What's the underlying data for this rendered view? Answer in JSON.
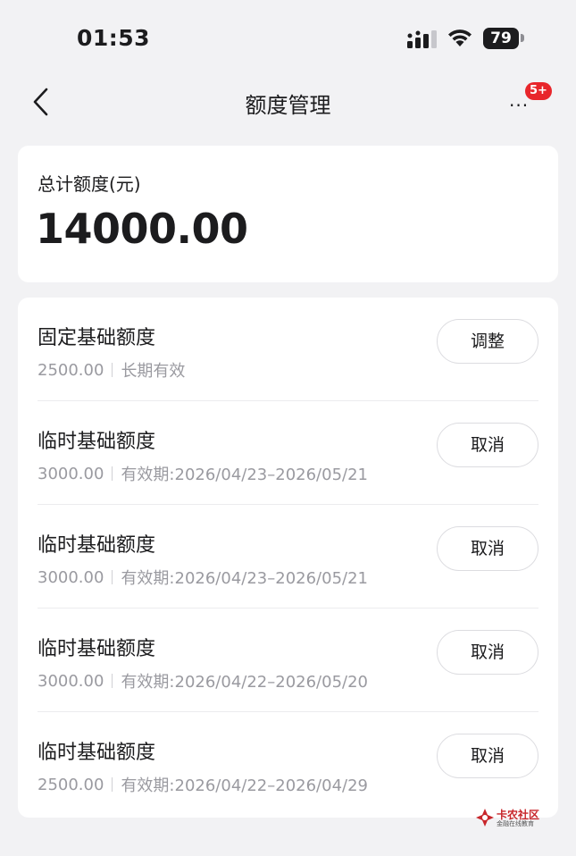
{
  "status_bar": {
    "time": "01:53",
    "battery": "79"
  },
  "nav": {
    "title": "额度管理",
    "badge": "5+",
    "more_dots": "···"
  },
  "total": {
    "label": "总计额度(元)",
    "amount": "14000.00"
  },
  "rows": [
    {
      "title": "固定基础额度",
      "amount": "2500.00",
      "detail": "长期有效",
      "button": "调整"
    },
    {
      "title": "临时基础额度",
      "amount": "3000.00",
      "detail": "有效期:2026/04/23–2026/05/21",
      "button": "取消"
    },
    {
      "title": "临时基础额度",
      "amount": "3000.00",
      "detail": "有效期:2026/04/23–2026/05/21",
      "button": "取消"
    },
    {
      "title": "临时基础额度",
      "amount": "3000.00",
      "detail": "有效期:2026/04/22–2026/05/20",
      "button": "取消"
    },
    {
      "title": "临时基础额度",
      "amount": "2500.00",
      "detail": "有效期:2026/04/22–2026/04/29",
      "button": "取消"
    }
  ],
  "watermark": {
    "title": "卡农社区",
    "subtitle": "金融在线教育"
  },
  "colors": {
    "background": "#f2f2f4",
    "badge": "#e8262b",
    "secondary_text": "#9a9aa0",
    "watermark": "#c8262b"
  }
}
